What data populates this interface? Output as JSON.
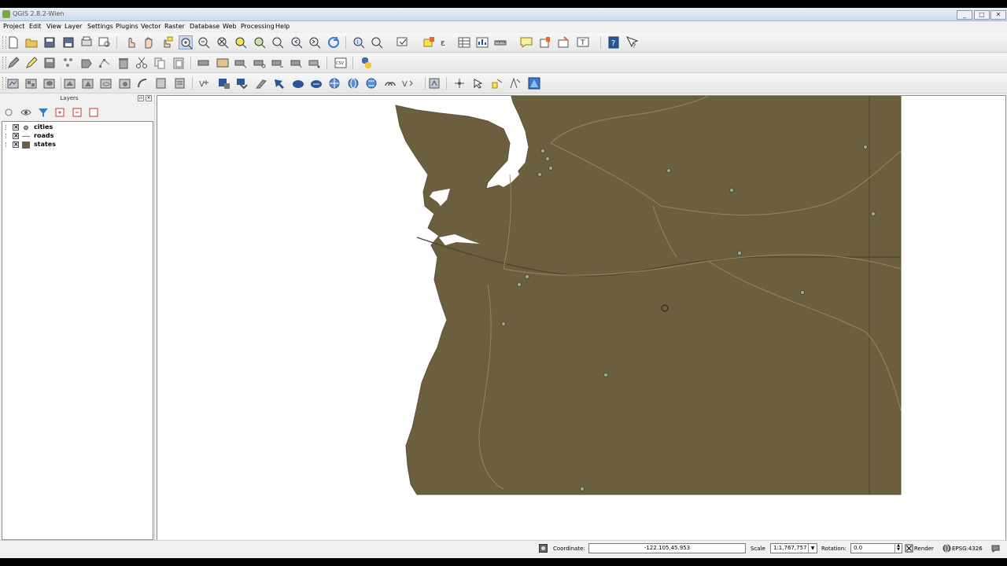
{
  "window": {
    "title": "QGIS 2.8.2-Wien",
    "controls": [
      "_",
      "□",
      "✕"
    ]
  },
  "menu": [
    "Project",
    "Edit",
    "View",
    "Layer",
    "Settings",
    "Plugins",
    "Vector",
    "Raster",
    "Database",
    "Web",
    "Processing",
    "Help"
  ],
  "toolbars": {
    "row1": [
      "new-project",
      "open-project",
      "save-project",
      "save-as",
      "print-composer",
      "composer-manager",
      "touch-zoom",
      "pan",
      "pan-to-selection",
      "zoom-in",
      "zoom-out",
      "zoom-full",
      "zoom-to-selection",
      "zoom-to-layer",
      "zoom-native",
      "zoom-last",
      "zoom-next",
      "refresh",
      "identify",
      "select-features",
      "select-by-expression",
      "deselect",
      "field-calculator",
      "attribute-table",
      "statistics",
      "measure",
      "map-tips",
      "bookmarks",
      "annotation",
      "text-annotation",
      "whats-this",
      "help"
    ],
    "row2": [
      "current-edits",
      "toggle-editing",
      "save-edits",
      "add-feature",
      "move-feature",
      "node-tool",
      "delete-selected",
      "cut-features",
      "copy-features",
      "paste-features",
      "label-pin",
      "label-show",
      "label-move",
      "label-rotate",
      "label-change",
      "label-highlight",
      "add-csv",
      "python-console"
    ],
    "row3": [
      "add-vector",
      "add-raster",
      "add-postgis",
      "add-spatialite",
      "add-mssql",
      "add-oracle",
      "add-wms",
      "add-wcs",
      "add-wfs",
      "add-delimited",
      "new-shapefile",
      "new-spatialite",
      "georeferencer",
      "geoprocessing",
      "vector-tools",
      "globe",
      "osm",
      "wfs-2",
      "openlayers",
      "vector-menu",
      "processing-toolbox",
      "gps",
      "road-graph",
      "spatial-query",
      "qgis-cloud",
      "topology"
    ]
  },
  "layers_panel": {
    "title": "Layers",
    "layers": [
      {
        "name": "cities",
        "visible": true,
        "symbol": "point"
      },
      {
        "name": "roads",
        "visible": true,
        "symbol": "line"
      },
      {
        "name": "states",
        "visible": true,
        "symbol": "polygon"
      }
    ]
  },
  "map": {
    "fill_color": "#6b5f3f",
    "background": "#ffffff"
  },
  "status": {
    "coordinate_label": "Coordinate:",
    "coordinate_value": "-122.105,45.953",
    "scale_label": "Scale",
    "scale_value": "1:1,767,757",
    "rotation_label": "Rotation:",
    "rotation_value": "0.0",
    "render_label": "Render",
    "crs_value": "EPSG:4326"
  }
}
